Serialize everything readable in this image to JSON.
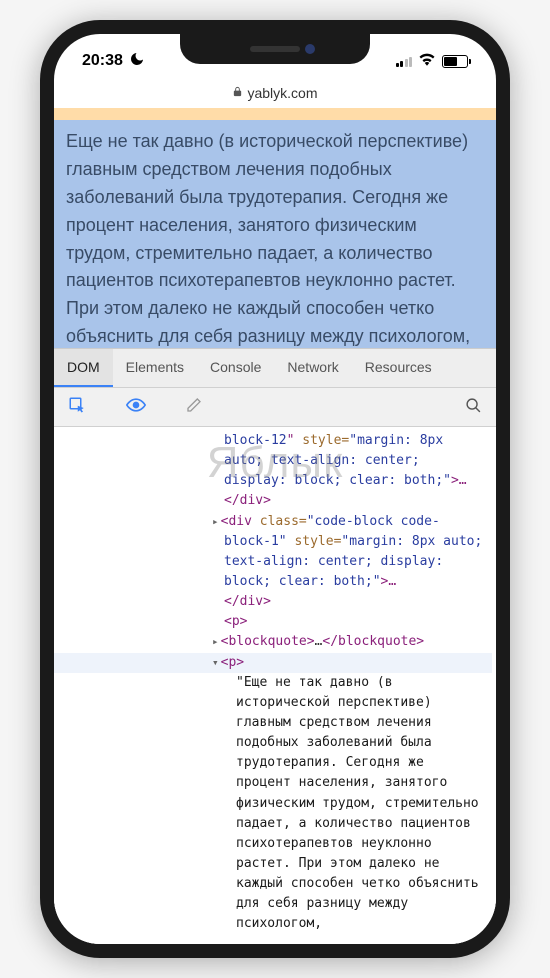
{
  "status": {
    "time": "20:38",
    "dnd_icon": "moon",
    "signal": "weak",
    "wifi": "on",
    "battery_pct": 55
  },
  "address_bar": {
    "lock": "🔒",
    "domain": "yablyk.com"
  },
  "page": {
    "paragraph": "Еще не так давно (в исторической перспективе) главным средством лечения подобных заболеваний была трудотерапия. Сегодня же процент населения, занятого физическим трудом, стремительно падает, а количество пациентов психотерапевтов неуклонно растет. При этом далеко не каждый способен четко объяснить для себя разницу между психологом,"
  },
  "devtools": {
    "tabs": [
      "DOM",
      "Elements",
      "Console",
      "Network",
      "Resources"
    ],
    "active_tab": 0,
    "toolbar_icons": {
      "inspect": "inspect-icon",
      "eye": "eye-icon",
      "pencil": "pencil-icon",
      "search": "search-icon"
    }
  },
  "watermark": "Яблык",
  "dom": {
    "line1_class": "block-12",
    "line1_style": "margin: 8px auto; text-align: center; display: block; clear: both;",
    "line1_close": "</div>",
    "line2_open": "<div",
    "line2_class_attr": " class=",
    "line2_class_val": "\"code-block code-block-1\"",
    "line2_style_attr": " style=",
    "line2_style_val": "\"margin: 8px auto; text-align: center; display: block; clear: both;\"",
    "line2_tail": ">…",
    "line2_close": "</div>",
    "p_empty": "<p>",
    "blockquote": "<blockquote>…</blockquote>",
    "p_open": "<p>",
    "p_text": "\"Еще не так давно (в исторической перспективе) главным средством лечения подобных заболеваний была трудотерапия. Сегодня же процент населения, занятого физическим трудом, стремительно падает, а количество пациентов психотерапевтов неуклонно растет. При этом далеко не каждый способен четко объяснить для себя разницу между психологом,"
  }
}
